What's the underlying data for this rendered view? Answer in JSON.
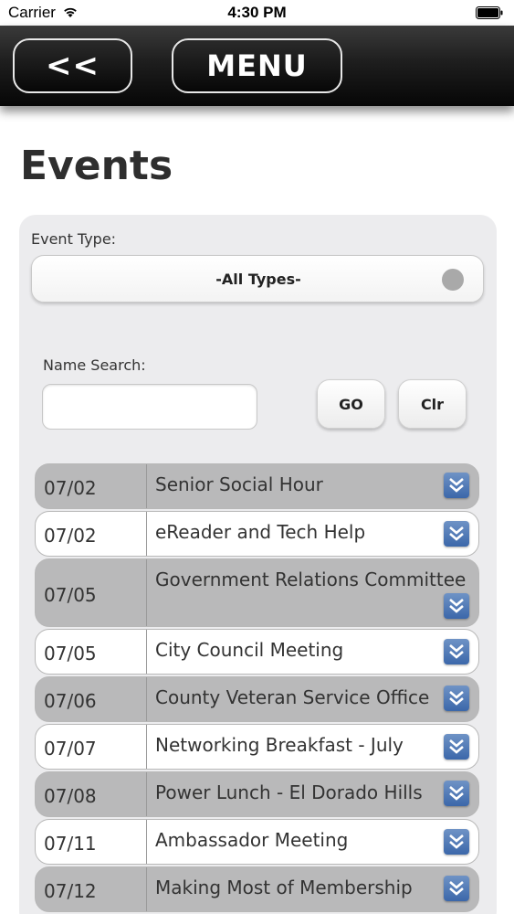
{
  "status_bar": {
    "carrier": "Carrier",
    "time": "4:30 PM"
  },
  "header": {
    "back_label": "<<",
    "menu_label": "MENU"
  },
  "page": {
    "title": "Events"
  },
  "filters": {
    "event_type_label": "Event Type:",
    "event_type_value": "-All Types-",
    "name_search_label": "Name Search:",
    "name_search_value": "",
    "go_label": "GO",
    "clear_label": "Clr"
  },
  "events": [
    {
      "date": "07/02",
      "name": "Senior Social Hour",
      "style": "gray"
    },
    {
      "date": "07/02",
      "name": "eReader and Tech Help",
      "style": "white"
    },
    {
      "date": "07/05",
      "name": "Government Relations Committee",
      "style": "gray"
    },
    {
      "date": "07/05",
      "name": "City Council Meeting",
      "style": "white"
    },
    {
      "date": "07/06",
      "name": "County Veteran Service Office",
      "style": "gray"
    },
    {
      "date": "07/07",
      "name": "Networking Breakfast - July",
      "style": "white"
    },
    {
      "date": "07/08",
      "name": "Power Lunch - El Dorado Hills",
      "style": "gray"
    },
    {
      "date": "07/11",
      "name": "Ambassador Meeting",
      "style": "white"
    },
    {
      "date": "07/12",
      "name": "Making Most of Membership",
      "style": "gray"
    }
  ],
  "colors": {
    "row_gray": "#b9b9ba",
    "row_white": "#ffffff",
    "chevron_blue": "#3b67aa",
    "header_dark": "#060606"
  },
  "icons": {
    "row_action": "double-chevron-down-icon",
    "wifi": "wifi-icon",
    "battery": "battery-icon"
  }
}
